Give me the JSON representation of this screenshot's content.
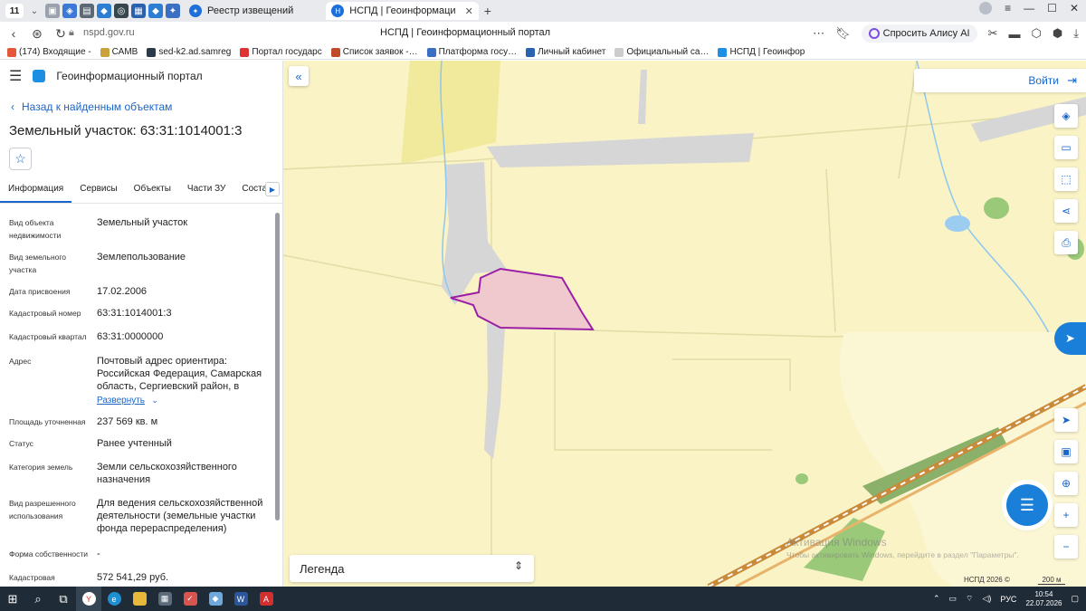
{
  "browser": {
    "tab_count": "11",
    "tabs": [
      {
        "label": "Реестр извещений",
        "active": false
      },
      {
        "label": "НСПД | Геоинформаци",
        "active": true
      }
    ],
    "url_host": "nspd.gov.ru",
    "page_title": "НСПД | Геоинформационный портал",
    "alice_label": "Спросить Алису AI",
    "bookmarks": [
      "(174) Входящие -",
      "САМВ",
      "sed-k2.ad.samreg",
      "Портал государс",
      "Список заявок -…",
      "Платформа госу…",
      "Личный кабинет",
      "Официальный са…",
      "НСПД | Геоинфор"
    ]
  },
  "panel": {
    "portal_name": "Геоинформационный портал",
    "back_label": "Назад к найденным объектам",
    "title": "Земельный участок: 63:31:1014001:3",
    "tabs": [
      "Информация",
      "Сервисы",
      "Объекты",
      "Части ЗУ",
      "Состав"
    ],
    "properties": [
      {
        "key": "Вид объекта недвижимости",
        "value": "Земельный участок"
      },
      {
        "key": "Вид земельного участка",
        "value": "Землепользование"
      },
      {
        "key": "Дата присвоения",
        "value": "17.02.2006"
      },
      {
        "key": "Кадастровый номер",
        "value": "63:31:1014001:3"
      },
      {
        "key": "Кадастровый квартал",
        "value": "63:31:0000000"
      },
      {
        "key": "Адрес",
        "value": "Почтовый адрес ориентира: Российская Федерация, Самарская область, Сергиевский район, в"
      },
      {
        "key": "Площадь уточненная",
        "value": "237 569 кв. м"
      },
      {
        "key": "Статус",
        "value": "Ранее учтенный"
      },
      {
        "key": "Категория земель",
        "value": "Земли сельскохозяйственного назначения"
      },
      {
        "key": "Вид разрешенного использования",
        "value": "Для ведения сельскохозяйственной деятельности (земельные участки фонда перераспределения)"
      },
      {
        "key": "Форма собственности",
        "value": "-"
      },
      {
        "key": "Кадастровая",
        "value": "572 541,29 руб."
      }
    ],
    "expand_label": "Развернуть"
  },
  "map": {
    "login_label": "Войти",
    "legend_label": "Легенда",
    "copyright": "НСПД 2026 ©",
    "scale": "200 м",
    "watermark_title": "Активация Windows",
    "watermark_sub": "Чтобы активировать Windows, перейдите в раздел \"Параметры\".",
    "colors": {
      "field": "#f9f3c6",
      "parcel_fill": "#f0c9cf",
      "parcel_stroke": "#9b1fa6",
      "gray_area": "#d6d6d6"
    }
  },
  "taskbar": {
    "language": "РУС",
    "time": "10:54",
    "date": "22.07.2026"
  }
}
